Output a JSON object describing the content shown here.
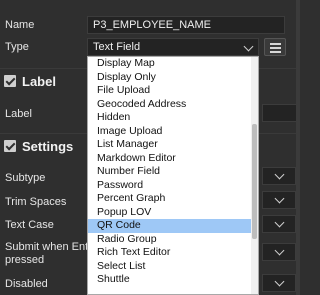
{
  "fields": {
    "name_label": "Name",
    "name_value": "P3_EMPLOYEE_NAME",
    "type_label": "Type",
    "type_value": "Text Field"
  },
  "sections": {
    "label_title": "Label",
    "label_field": "Label",
    "settings_title": "Settings",
    "subtype_label": "Subtype",
    "trim_label": "Trim Spaces",
    "textcase_label": "Text Case",
    "submit_label_line1": "Submit when Enter",
    "submit_label_line2": "pressed",
    "disabled_label": "Disabled"
  },
  "dropdown": {
    "items": [
      "Display Map",
      "Display Only",
      "File Upload",
      "Geocoded Address",
      "Hidden",
      "Image Upload",
      "List Manager",
      "Markdown Editor",
      "Number Field",
      "Password",
      "Percent Graph",
      "Popup LOV",
      "QR Code",
      "Radio Group",
      "Rich Text Editor",
      "Select List",
      "Shuttle"
    ],
    "selected": "QR Code"
  },
  "icons": {
    "type_button": "list-icon",
    "section_toggle": "checkbox-collapse-icon",
    "select_arrow": "chevron-down-icon"
  },
  "colors": {
    "background": "#2f2f2f",
    "input_bg": "#232323",
    "highlight": "#9ec8f6"
  }
}
